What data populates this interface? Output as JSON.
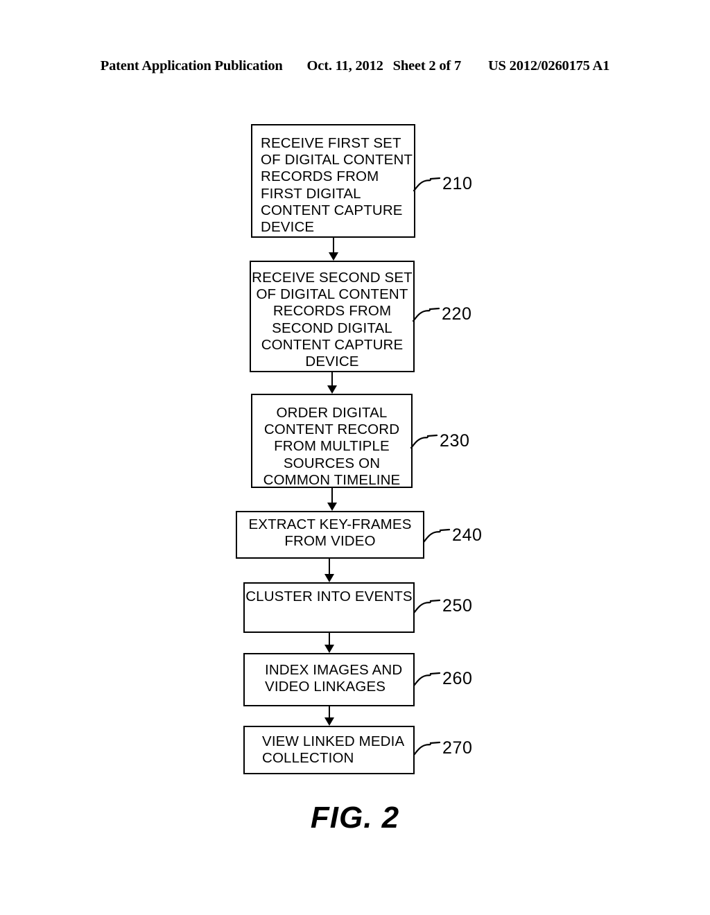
{
  "header": {
    "publication_label": "Patent Application Publication",
    "date": "Oct. 11, 2012",
    "sheet": "Sheet 2 of 7",
    "publication_number": "US 2012/0260175 A1"
  },
  "figure": {
    "caption": "FIG. 2",
    "line_color": "#000000",
    "background_color": "#ffffff"
  },
  "flowchart": {
    "type": "flowchart",
    "orientation": "top-to-bottom",
    "nodes": [
      {
        "ref": "210",
        "text": "RECEIVE FIRST SET\nOF DIGITAL CONTENT\nRECORDS FROM\nFIRST DIGITAL\nCONTENT CAPTURE\nDEVICE",
        "align": "left"
      },
      {
        "ref": "220",
        "text": "RECEIVE SECOND SET\nOF DIGITAL CONTENT\nRECORDS FROM\nSECOND DIGITAL\nCONTENT CAPTURE\nDEVICE",
        "align": "center"
      },
      {
        "ref": "230",
        "text": "ORDER DIGITAL\nCONTENT RECORD\nFROM MULTIPLE\nSOURCES ON\nCOMMON TIMELINE",
        "align": "center"
      },
      {
        "ref": "240",
        "text": "EXTRACT KEY-FRAMES\nFROM VIDEO",
        "align": "center"
      },
      {
        "ref": "250",
        "text": "CLUSTER INTO EVENTS",
        "align": "center"
      },
      {
        "ref": "260",
        "text": "INDEX IMAGES AND\nVIDEO LINKAGES",
        "align": "left"
      },
      {
        "ref": "270",
        "text": "VIEW LINKED MEDIA\nCOLLECTION",
        "align": "left"
      }
    ],
    "edges": [
      {
        "from": "210",
        "to": "220"
      },
      {
        "from": "220",
        "to": "230"
      },
      {
        "from": "230",
        "to": "240"
      },
      {
        "from": "240",
        "to": "250"
      },
      {
        "from": "250",
        "to": "260"
      },
      {
        "from": "260",
        "to": "270"
      }
    ]
  }
}
